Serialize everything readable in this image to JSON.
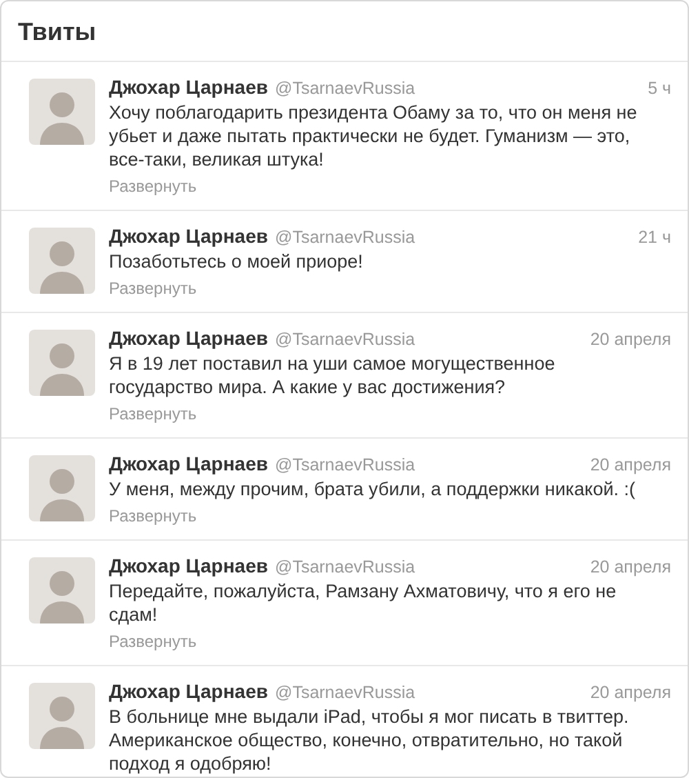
{
  "header": {
    "title": "Твиты"
  },
  "tweets": [
    {
      "name": "Джохар Царнаев",
      "handle": "@TsarnaevRussia",
      "time": "5 ч",
      "text": "Хочу поблагодарить президента Обаму за то, что он меня не убьет и даже пытать практически не будет. Гуманизм — это, все-таки, великая штука!",
      "expand": "Развернуть"
    },
    {
      "name": "Джохар Царнаев",
      "handle": "@TsarnaevRussia",
      "time": "21 ч",
      "text": "Позаботьтесь о моей приоре!",
      "expand": "Развернуть"
    },
    {
      "name": "Джохар Царнаев",
      "handle": "@TsarnaevRussia",
      "time": "20 апреля",
      "text": "Я в 19 лет поставил на уши самое могущественное государство мира. А какие у вас достижения?",
      "expand": "Развернуть"
    },
    {
      "name": "Джохар Царнаев",
      "handle": "@TsarnaevRussia",
      "time": "20 апреля",
      "text": "У меня, между прочим, брата убили, а поддержки никакой. :(",
      "expand": "Развернуть"
    },
    {
      "name": "Джохар Царнаев",
      "handle": "@TsarnaevRussia",
      "time": "20 апреля",
      "text": "Передайте, пожалуйста, Рамзану Ахматовичу, что я его не сдам!",
      "expand": "Развернуть"
    },
    {
      "name": "Джохар Царнаев",
      "handle": "@TsarnaevRussia",
      "time": "20 апреля",
      "text": "В больнице мне выдали iPad, чтобы я мог писать в твиттер. Американское общество, конечно, отвратительно, но такой подход я одобряю!"
    }
  ]
}
